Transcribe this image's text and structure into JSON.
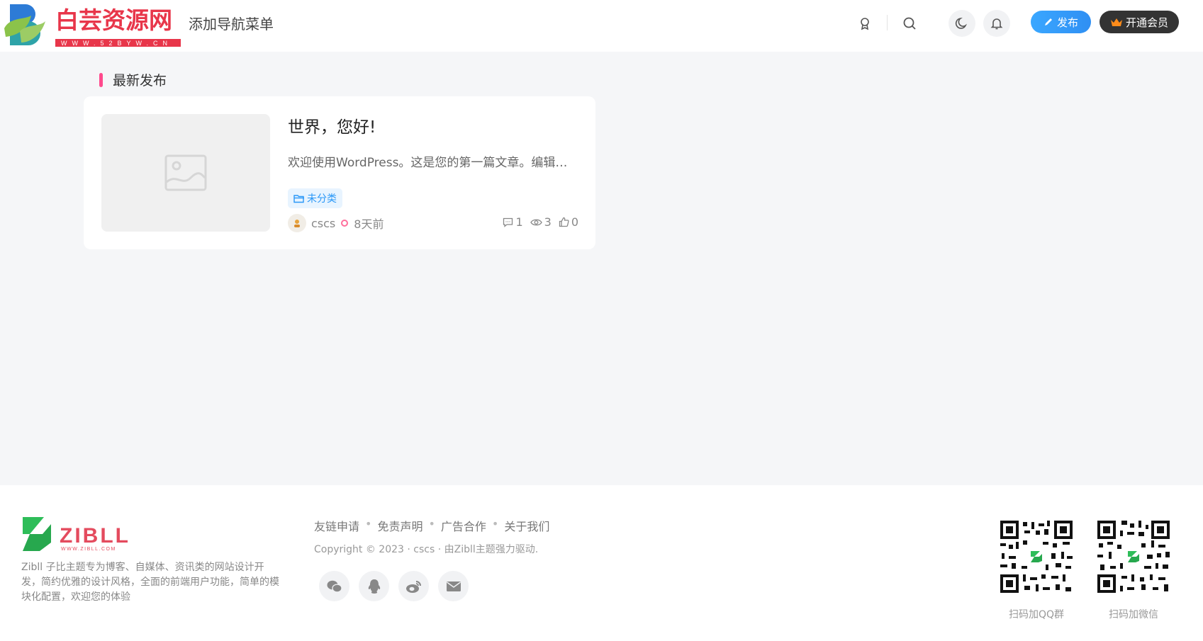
{
  "header": {
    "logo_text": "白芸资源网",
    "logo_subtext": "WWW.52BYW.CN",
    "nav_menu_label": "添加导航菜单",
    "icons": [
      "award-icon",
      "search-icon",
      "moon-icon",
      "bell-icon"
    ],
    "publish_label": "发布",
    "vip_label": "开通会员"
  },
  "main": {
    "section_title": "最新发布",
    "post": {
      "title": "世界，您好!",
      "excerpt": "欢迎使用WordPress。这是您的第一篇文章。编辑…",
      "category": "未分类",
      "author": "cscs",
      "time": "8天前",
      "comments": "1",
      "views": "3",
      "likes": "0"
    }
  },
  "footer": {
    "logo_text": "ZIBLL",
    "logo_subtext": "WWW.ZIBLL.COM",
    "description": "Zibll 子比主题专为博客、自媒体、资讯类的网站设计开发，简约优雅的设计风格，全面的前端用户功能，简单的模块化配置，欢迎您的体验",
    "links": [
      "友链申请",
      "免责声明",
      "广告合作",
      "关于我们"
    ],
    "copyright": "Copyright © 2023 · cscs · 由Zibll主题强力驱动.",
    "social_icons": [
      "wechat-icon",
      "qq-icon",
      "weibo-icon",
      "mail-icon"
    ],
    "qr_qq_label": "扫码加QQ群",
    "qr_wechat_label": "扫码加微信"
  },
  "colors": {
    "accent_pink": "#ff4a8d",
    "publish_blue": "#2f8ff3",
    "vip_dark": "#333333",
    "category_blue": "#2997f7",
    "zibll_green": "#2ebd59",
    "zibll_red": "#e44b5e"
  }
}
